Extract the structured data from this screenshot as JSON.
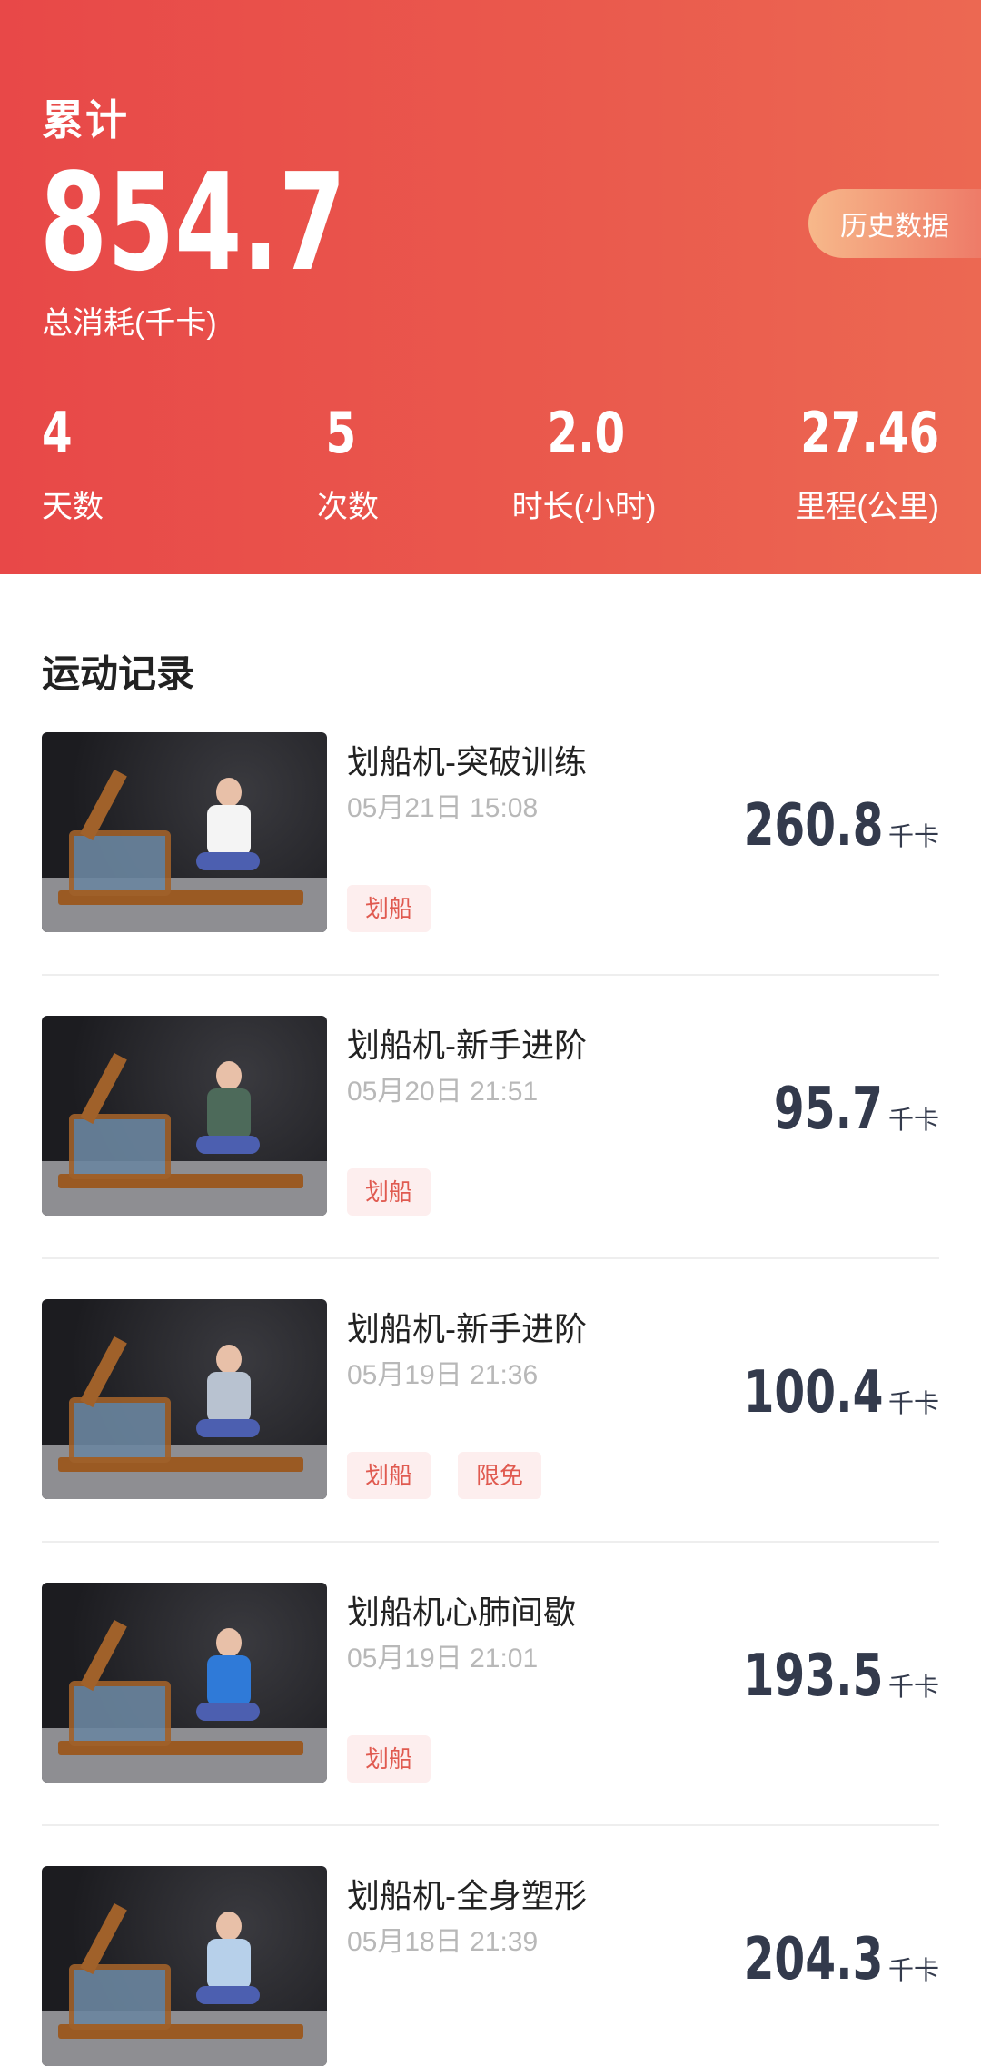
{
  "summary": {
    "title": "累计",
    "total": "854.7",
    "total_label": "总消耗(千卡)",
    "history_button": "历史数据",
    "stats": [
      {
        "value": "4",
        "label": "天数"
      },
      {
        "value": "5",
        "label": "次数"
      },
      {
        "value": "2.0",
        "label": "时长(小时)"
      },
      {
        "value": "27.46",
        "label": "里程(公里)"
      }
    ]
  },
  "records_title": "运动记录",
  "records": [
    {
      "title": "划船机-突破训练",
      "date": "05月21日 15:08",
      "kcal": "260.8",
      "unit": "千卡",
      "tags": [
        "划船"
      ]
    },
    {
      "title": "划船机-新手进阶",
      "date": "05月20日 21:51",
      "kcal": "95.7",
      "unit": "千卡",
      "tags": [
        "划船"
      ]
    },
    {
      "title": "划船机-新手进阶",
      "date": "05月19日 21:36",
      "kcal": "100.4",
      "unit": "千卡",
      "tags": [
        "划船",
        "限免"
      ]
    },
    {
      "title": "划船机心肺间歇",
      "date": "05月19日 21:01",
      "kcal": "193.5",
      "unit": "千卡",
      "tags": [
        "划船"
      ]
    },
    {
      "title": "划船机-全身塑形",
      "date": "05月18日 21:39",
      "kcal": "204.3",
      "unit": "千卡",
      "tags": []
    }
  ],
  "colors": {
    "accent": "#e84848",
    "tag_bg": "#fdeeee",
    "tag_text": "#e05a50"
  }
}
